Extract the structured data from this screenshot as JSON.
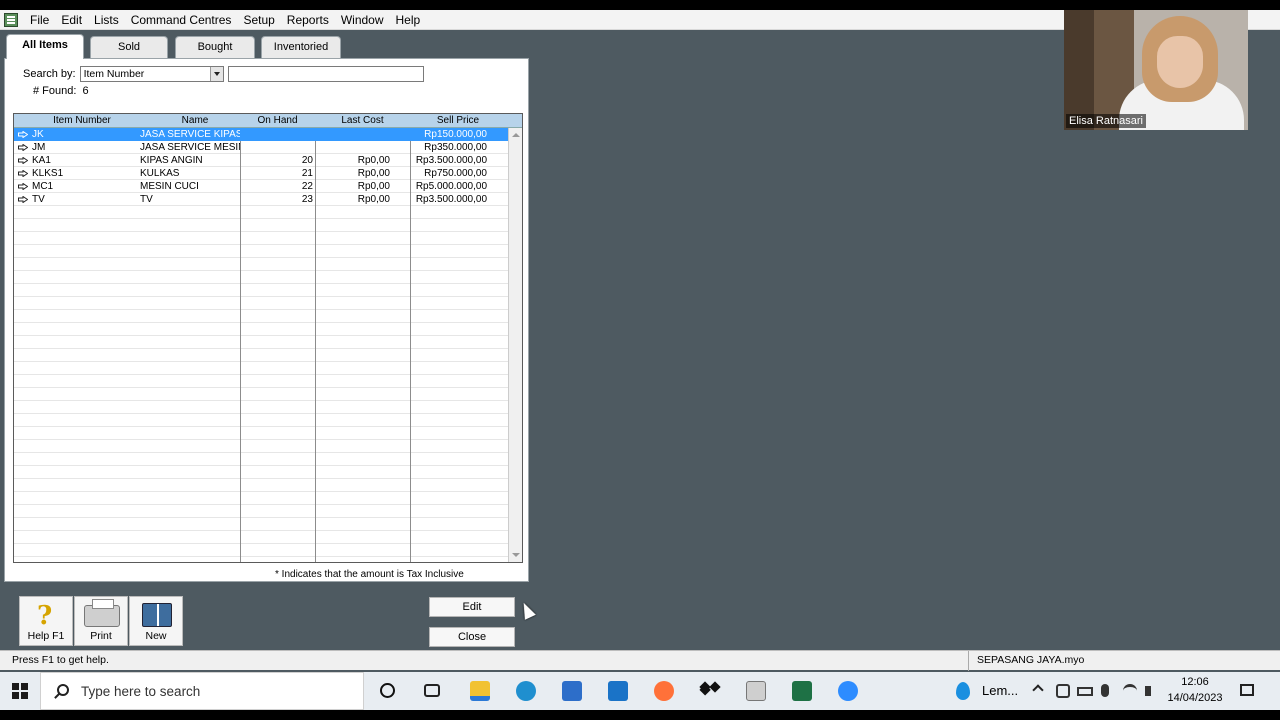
{
  "menu": [
    "File",
    "Edit",
    "Lists",
    "Command Centres",
    "Setup",
    "Reports",
    "Window",
    "Help"
  ],
  "tabs": {
    "all": "All Items",
    "sold": "Sold",
    "bought": "Bought",
    "inventoried": "Inventoried"
  },
  "search": {
    "label": "Search by:",
    "field": "Item Number",
    "value": "",
    "found_label": "# Found:",
    "found_count": "6"
  },
  "table": {
    "columns": [
      "Item Number",
      "Name",
      "On Hand",
      "Last Cost",
      "Sell Price"
    ],
    "rows": [
      {
        "item": "JK",
        "name": "JASA SERVICE KIPAS",
        "on_hand": "",
        "last_cost": "",
        "sell_price": "Rp150.000,00",
        "selected": true
      },
      {
        "item": "JM",
        "name": "JASA SERVICE MESIN",
        "on_hand": "",
        "last_cost": "",
        "sell_price": "Rp350.000,00"
      },
      {
        "item": "KA1",
        "name": "KIPAS ANGIN",
        "on_hand": "20",
        "last_cost": "Rp0,00",
        "sell_price": "Rp3.500.000,00"
      },
      {
        "item": "KLKS1",
        "name": "KULKAS",
        "on_hand": "21",
        "last_cost": "Rp0,00",
        "sell_price": "Rp750.000,00"
      },
      {
        "item": "MC1",
        "name": "MESIN CUCI",
        "on_hand": "22",
        "last_cost": "Rp0,00",
        "sell_price": "Rp5.000.000,00"
      },
      {
        "item": "TV",
        "name": "TV",
        "on_hand": "23",
        "last_cost": "Rp0,00",
        "sell_price": "Rp3.500.000,00"
      }
    ]
  },
  "tax_note": "* Indicates that the amount is Tax Inclusive",
  "buttons": {
    "help": "Help F1",
    "print": "Print",
    "new": "New",
    "edit": "Edit",
    "close": "Close"
  },
  "status": {
    "left": "Press F1 to get help.",
    "right": "SEPASANG JAYA.myo"
  },
  "taskbar": {
    "search_placeholder": "Type here to search",
    "weather": "Lem...",
    "time": "12:06",
    "date": "14/04/2023"
  },
  "video": {
    "participant": "Elisa Ratnasari"
  },
  "colors": {
    "desktop": "#4e5a61",
    "selection": "#3399ff",
    "header": "#b7d3ea"
  }
}
